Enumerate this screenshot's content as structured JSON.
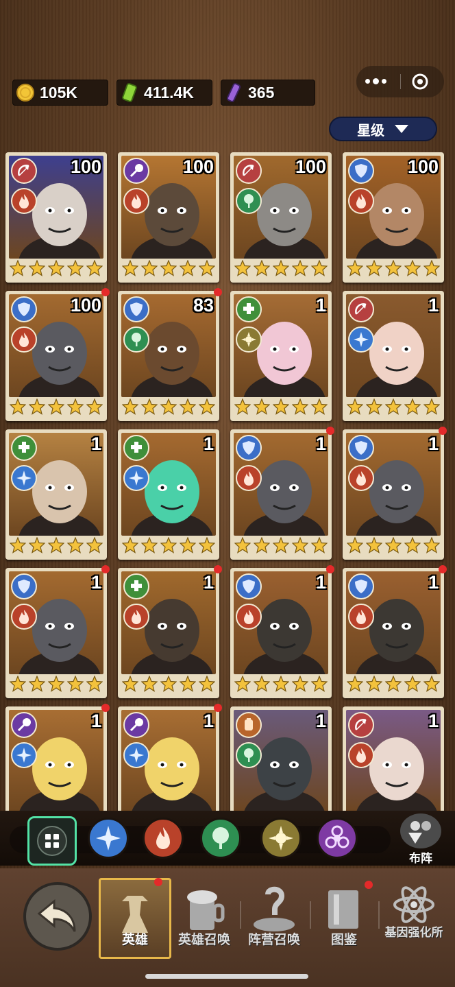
{
  "resources": {
    "gold": "105K",
    "energy": "411.4K",
    "serum": "365"
  },
  "sort": {
    "label": "星级"
  },
  "colors": {
    "protect": "#2e64b3",
    "fire": "#b9422a",
    "nature": "#2e8f52",
    "light": "#8a7a33",
    "toxic": "#7e3aa3",
    "bow": "#b64040",
    "shield": "#3b6ec7",
    "heal": "#3f8f3a",
    "mace": "#6b3aa3",
    "punch": "#b8652b",
    "frost": "#3a78d0"
  },
  "heroes": [
    {
      "level": "100",
      "role": "bow-icon",
      "faction": "fire-icon",
      "dot": false,
      "bg": "#3d3f8f",
      "face": "#d9d0c8"
    },
    {
      "level": "100",
      "role": "mace-icon",
      "faction": "fire-icon",
      "dot": false,
      "bg": "#b57632",
      "face": "#5c4a3a"
    },
    {
      "level": "100",
      "role": "bow-icon",
      "faction": "nature-icon",
      "dot": false,
      "bg": "#a0692d",
      "face": "#8d8a86"
    },
    {
      "level": "100",
      "role": "shield-icon",
      "faction": "fire-icon",
      "dot": false,
      "bg": "#a36227",
      "face": "#b38766"
    },
    {
      "level": "100",
      "role": "shield-icon",
      "faction": "fire-icon",
      "dot": true,
      "bg": "#a36a30",
      "face": "#5a5a60"
    },
    {
      "level": "83",
      "role": "shield-icon",
      "faction": "nature-icon",
      "dot": true,
      "bg": "#a66a30",
      "face": "#6b4a2f"
    },
    {
      "level": "1",
      "role": "heal-icon",
      "faction": "light-icon",
      "dot": false,
      "bg": "#a56c35",
      "face": "#f1c7d5"
    },
    {
      "level": "1",
      "role": "bow-icon",
      "faction": "frost-icon",
      "dot": false,
      "bg": "#8a5a2e",
      "face": "#f0d2c6"
    },
    {
      "level": "1",
      "role": "heal-icon",
      "faction": "frost-icon",
      "dot": false,
      "bg": "#b58242",
      "face": "#d9c4ad"
    },
    {
      "level": "1",
      "role": "heal-icon",
      "faction": "frost-icon",
      "dot": false,
      "bg": "#a56a30",
      "face": "#4ad0a8"
    },
    {
      "level": "1",
      "role": "shield-icon",
      "faction": "fire-icon",
      "dot": true,
      "bg": "#a36a30",
      "face": "#5a5a60"
    },
    {
      "level": "1",
      "role": "shield-icon",
      "faction": "fire-icon",
      "dot": true,
      "bg": "#a36a30",
      "face": "#5a5a60"
    },
    {
      "level": "1",
      "role": "shield-icon",
      "faction": "fire-icon",
      "dot": true,
      "bg": "#a36a30",
      "face": "#5a5a60"
    },
    {
      "level": "1",
      "role": "heal-icon",
      "faction": "fire-icon",
      "dot": true,
      "bg": "#a0692d",
      "face": "#463a30"
    },
    {
      "level": "1",
      "role": "shield-icon",
      "faction": "fire-icon",
      "dot": true,
      "bg": "#9a6030",
      "face": "#3c3833"
    },
    {
      "level": "1",
      "role": "shield-icon",
      "faction": "fire-icon",
      "dot": true,
      "bg": "#9a6030",
      "face": "#3c3833"
    },
    {
      "level": "1",
      "role": "mace-icon",
      "faction": "frost-icon",
      "dot": true,
      "bg": "#a86e33",
      "face": "#f0d36a"
    },
    {
      "level": "1",
      "role": "mace-icon",
      "faction": "frost-icon",
      "dot": true,
      "bg": "#a86e33",
      "face": "#f0d36a"
    },
    {
      "level": "1",
      "role": "punch-icon",
      "faction": "nature-icon",
      "dot": false,
      "bg": "#6a5a7a",
      "face": "#3d4246"
    },
    {
      "level": "1",
      "role": "bow-icon",
      "faction": "fire-icon",
      "dot": false,
      "bg": "#7a5a86",
      "face": "#ead8cf"
    }
  ],
  "filters": [
    "all-filter",
    "frost-filter",
    "fire-filter",
    "nature-filter",
    "light-filter",
    "toxic-filter"
  ],
  "formation": {
    "label": "布阵"
  },
  "nav": {
    "heroes": "英雄",
    "hero_summon": "英雄召唤",
    "faction_summon": "阵营召唤",
    "codex": "图鉴",
    "gene_lab": "基因强化所"
  }
}
